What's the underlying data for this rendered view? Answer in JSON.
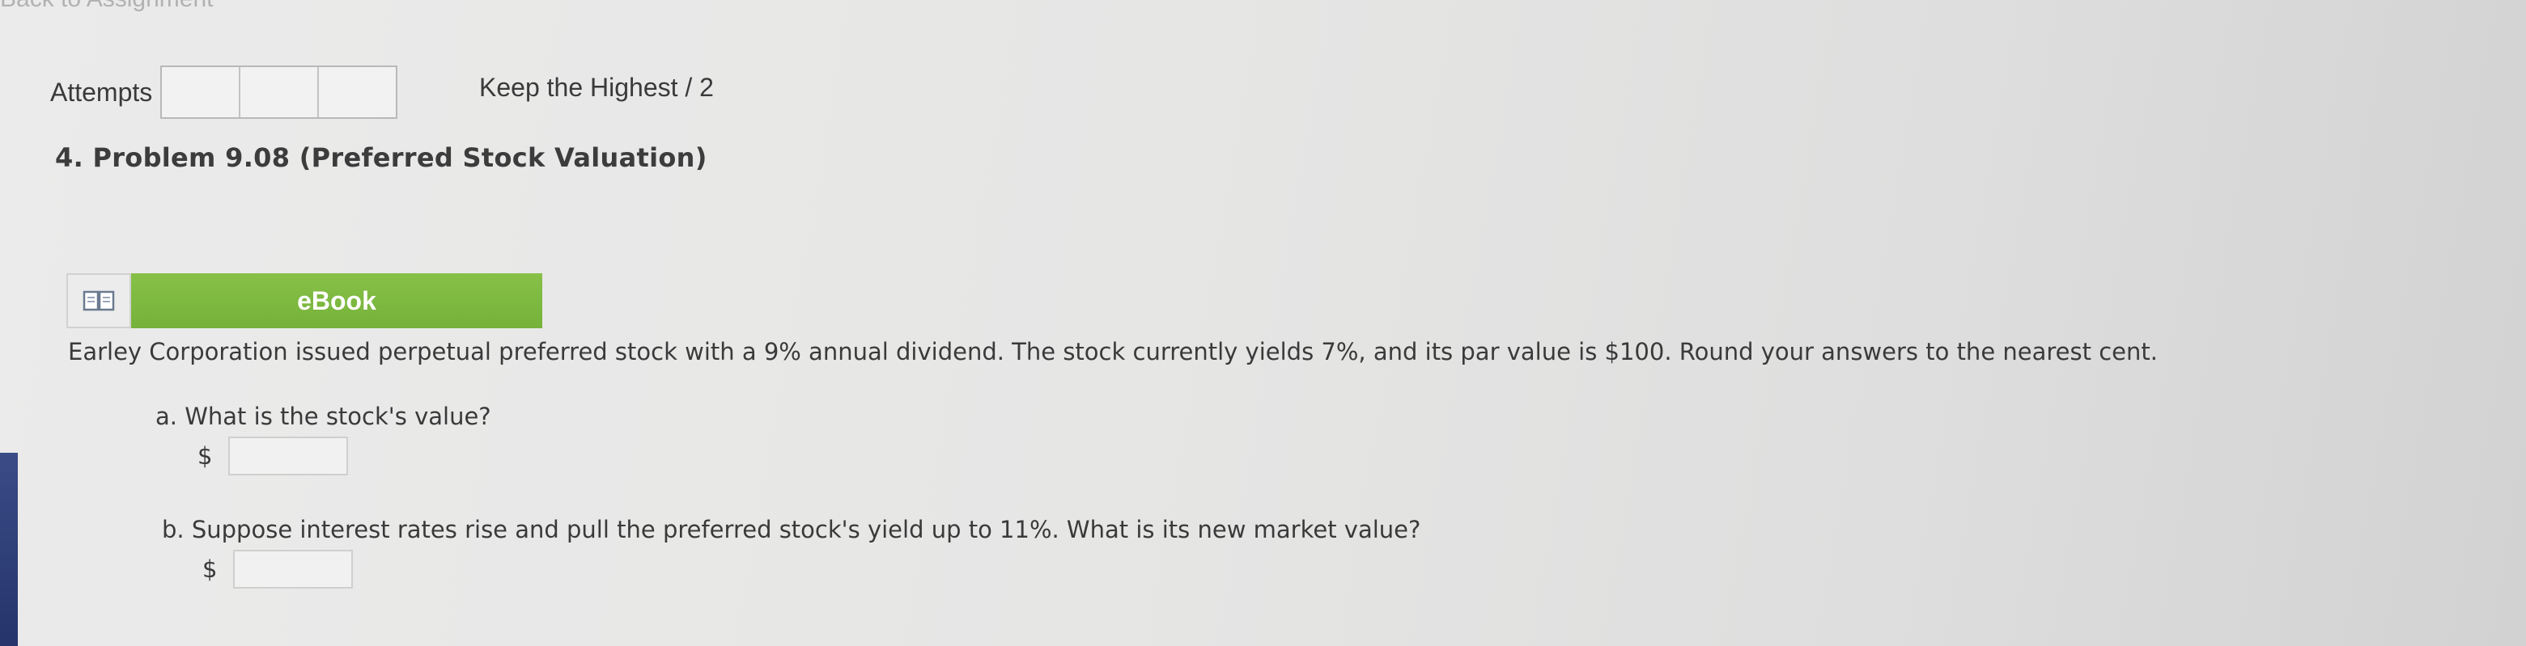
{
  "header": {
    "back_link_fragment": "Back to Assignment"
  },
  "attempts": {
    "label": "Attempts",
    "boxes": 3,
    "keep_highest": "Keep the Highest / 2"
  },
  "problem": {
    "title": "4.  Problem 9.08 (Preferred Stock Valuation)",
    "ebook_label": "eBook",
    "question": "Earley Corporation issued perpetual preferred stock with a 9% annual dividend. The stock currently yields 7%, and its par value is $100. Round your answers to the nearest cent.",
    "parts": [
      {
        "prefix": "a.",
        "text": "What is the stock's value?",
        "currency": "$",
        "value": ""
      },
      {
        "prefix": "b.",
        "text": "Suppose interest rates rise and pull the preferred stock's yield up to 11%. What is its new market value?",
        "currency": "$",
        "value": ""
      }
    ]
  },
  "colors": {
    "ebook_green": "#7fb842",
    "background": "#e8e8e7"
  },
  "icons": {
    "ebook": "open-book-icon"
  }
}
